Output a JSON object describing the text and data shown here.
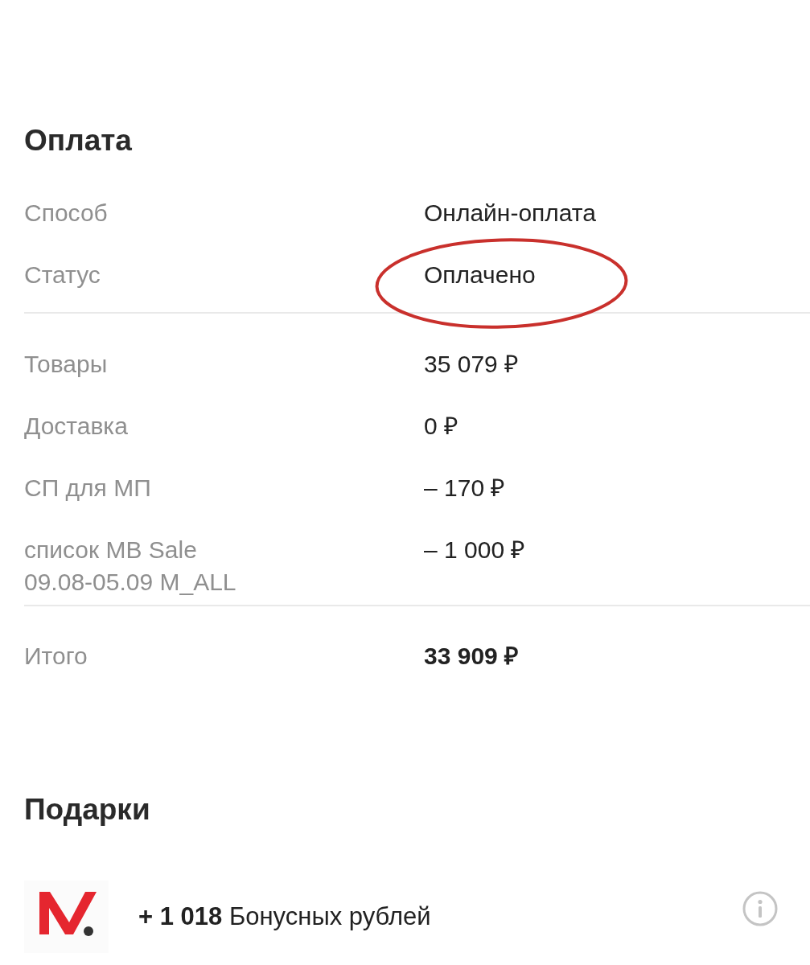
{
  "payment": {
    "title": "Оплата",
    "groups": [
      {
        "rows": [
          {
            "label": "Способ",
            "value": "Онлайн-оплата",
            "kind": "plain",
            "circled": false
          },
          {
            "label": "Статус",
            "value": "Оплачено",
            "kind": "plain",
            "circled": true
          }
        ]
      },
      {
        "rows": [
          {
            "label": "Товары",
            "value": "35 079 ₽",
            "kind": "plain",
            "circled": false
          },
          {
            "label": "Доставка",
            "value": "0 ₽",
            "kind": "plain",
            "circled": false
          },
          {
            "label": "СП для МП",
            "value": "– 170 ₽",
            "kind": "plain",
            "circled": false
          },
          {
            "label": "список MB Sale 09.08-05.09 M_ALL",
            "value": "– 1 000 ₽",
            "kind": "plain",
            "circled": false
          }
        ]
      },
      {
        "rows": [
          {
            "label": "Итого",
            "value": "33 909 ₽",
            "kind": "total",
            "circled": false
          }
        ]
      }
    ]
  },
  "gifts": {
    "title": "Подарки",
    "items": [
      {
        "text": "**+ 1 018** Бонусных рублей"
      }
    ]
  }
}
